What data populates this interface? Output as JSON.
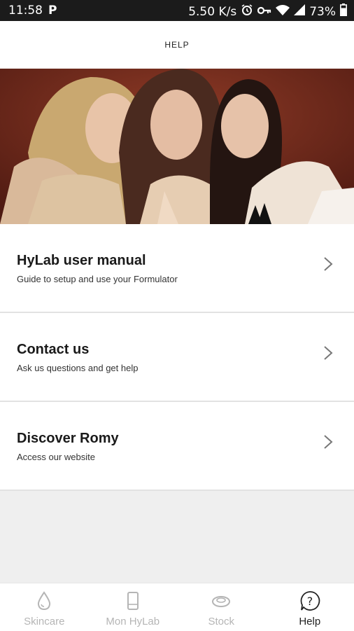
{
  "status_bar": {
    "time": "11:58",
    "app_badge": "P",
    "speed": "5.50 K/s",
    "battery": "73%",
    "icons": [
      "alarm-icon",
      "vpn-key-icon",
      "wifi-icon",
      "signal-icon",
      "battery-icon"
    ]
  },
  "header": {
    "title": "HELP"
  },
  "hero": {
    "image": "three-women-portrait"
  },
  "menu": {
    "items": [
      {
        "title": "HyLab user manual",
        "subtitle": "Guide to setup and use your Formulator"
      },
      {
        "title": "Contact us",
        "subtitle": "Ask us questions and get help"
      },
      {
        "title": "Discover Romy",
        "subtitle": "Access our website"
      }
    ]
  },
  "bottom_nav": {
    "items": [
      {
        "label": "Skincare",
        "icon": "droplet-icon",
        "active": false
      },
      {
        "label": "Mon HyLab",
        "icon": "device-icon",
        "active": false
      },
      {
        "label": "Stock",
        "icon": "capsule-icon",
        "active": false
      },
      {
        "label": "Help",
        "icon": "help-icon",
        "active": true
      }
    ]
  },
  "colors": {
    "accent": "#222222",
    "inactive": "#b5b5b5",
    "background": "#efefef",
    "status_bar": "#1b1b1b"
  }
}
